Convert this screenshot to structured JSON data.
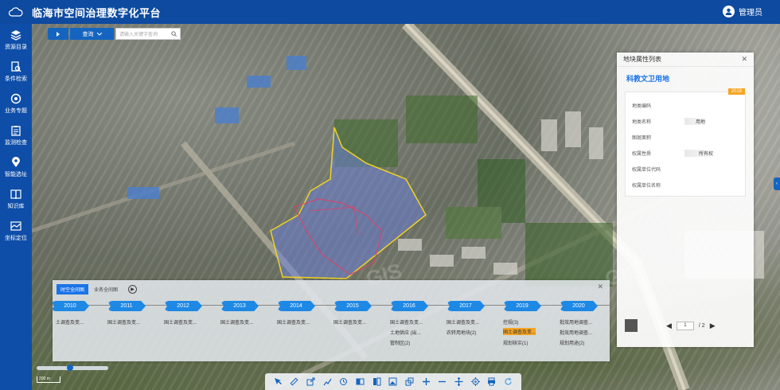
{
  "header": {
    "title": "临海市空间治理数字化平台",
    "user": "管理员"
  },
  "sidebar": {
    "items": [
      {
        "label": "资源目录",
        "icon": "layers-icon"
      },
      {
        "label": "条件检索",
        "icon": "doc-search-icon"
      },
      {
        "label": "业务专题",
        "icon": "topic-icon"
      },
      {
        "label": "监测检查",
        "icon": "clipboard-icon"
      },
      {
        "label": "智能选址",
        "icon": "location-icon"
      },
      {
        "label": "知识库",
        "icon": "book-icon"
      },
      {
        "label": "坐标定位",
        "icon": "coordinate-icon"
      }
    ]
  },
  "search": {
    "toggle_icon": "play-icon",
    "select_value": "查询",
    "placeholder": "请输入关键字查询"
  },
  "property_panel": {
    "title": "地块属性列表",
    "subtitle": "科教文卫用地",
    "year_badge": "2019",
    "rows": [
      {
        "label": "地类编码",
        "value": ""
      },
      {
        "label": "地类名称",
        "value": "用地"
      },
      {
        "label": "图斑面积",
        "value": ""
      },
      {
        "label": "权属性质",
        "value": "所有权"
      },
      {
        "label": "权属单位代码",
        "value": ""
      },
      {
        "label": "权属单位名称",
        "value": ""
      }
    ],
    "pager": {
      "current": "1",
      "total": "/ 2"
    }
  },
  "timeline": {
    "tabs": [
      {
        "label": "时空全间图",
        "active": true
      },
      {
        "label": "业务全间图",
        "active": false
      }
    ],
    "years": [
      {
        "year": "2010",
        "items": [
          "土调查及变..."
        ]
      },
      {
        "year": "2011",
        "items": [
          "国土调查及变..."
        ]
      },
      {
        "year": "2012",
        "items": [
          "国土调查及变..."
        ]
      },
      {
        "year": "2013",
        "items": [
          "国土调查及变..."
        ]
      },
      {
        "year": "2014",
        "items": [
          "国土调查及变..."
        ]
      },
      {
        "year": "2015",
        "items": [
          "国土调查及变..."
        ]
      },
      {
        "year": "2016",
        "items": [
          "国土调查及变...",
          "土地供应 (出...",
          "管制区(2)"
        ]
      },
      {
        "year": "2017",
        "items": [
          "国土调查及变...",
          "农转用地块(2)"
        ]
      },
      {
        "year": "2019",
        "items": [
          "控规(3)",
          "国土调查及变...",
          "规划核实(1)"
        ],
        "highlight_index": 1
      },
      {
        "year": "2020",
        "items": [
          "批效用地调查...",
          "批效用地调查...",
          "规划用途(2)"
        ]
      }
    ]
  },
  "scale": {
    "label": "200 m"
  },
  "toolbar": {
    "tools": [
      "select-icon",
      "measure-icon",
      "export-icon",
      "chart-icon",
      "history-icon",
      "split-icon",
      "layout-icon",
      "image-icon",
      "share-icon",
      "zoom-in-icon",
      "zoom-out-icon",
      "pan-icon",
      "locate-icon",
      "print-icon",
      "refresh-icon"
    ]
  },
  "map": {
    "watermark": "GIS"
  }
}
